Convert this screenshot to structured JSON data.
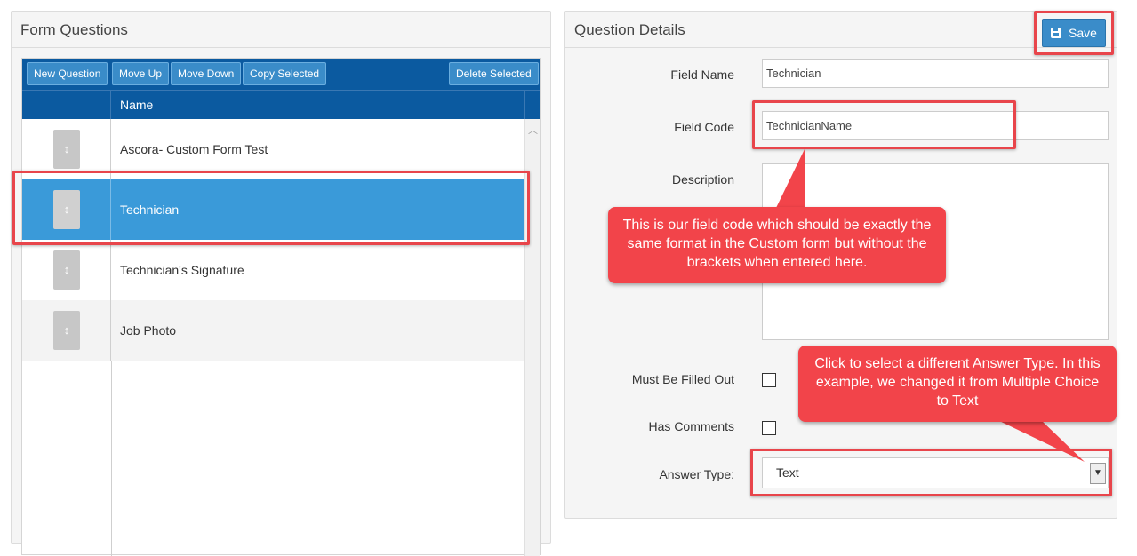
{
  "left_panel": {
    "title": "Form Questions",
    "toolbar": {
      "new_question": "New Question",
      "move_up": "Move Up",
      "move_down": "Move Down",
      "copy_selected": "Copy Selected",
      "delete_selected": "Delete Selected"
    },
    "columns": {
      "name": "Name"
    },
    "rows": [
      {
        "label": "Ascora- Custom Form Test",
        "selected": false
      },
      {
        "label": "Technician",
        "selected": true
      },
      {
        "label": "Technician's Signature",
        "selected": false
      },
      {
        "label": "Job Photo",
        "selected": false
      }
    ]
  },
  "right_panel": {
    "title": "Question Details",
    "save_label": "Save",
    "field_name_label": "Field Name",
    "field_name_value": "Technician",
    "field_code_label": "Field Code",
    "field_code_value": "TechnicianName",
    "description_label": "Description",
    "must_fill_label": "Must Be Filled Out",
    "has_comments_label": "Has Comments",
    "answer_type_label": "Answer Type:",
    "answer_type_value": "Text"
  },
  "annotations": {
    "field_code_note": "This is our field code which should be exactly the same format in the Custom form but without the brackets when entered here.",
    "answer_type_note": "Click to select a different Answer Type. In this example, we changed it from Multiple Choice to Text"
  },
  "colors": {
    "toolbar": "#0b5aa0",
    "button": "#3a8cc9",
    "selected_row": "#3a9ad9",
    "annotation": "#f2444a"
  }
}
